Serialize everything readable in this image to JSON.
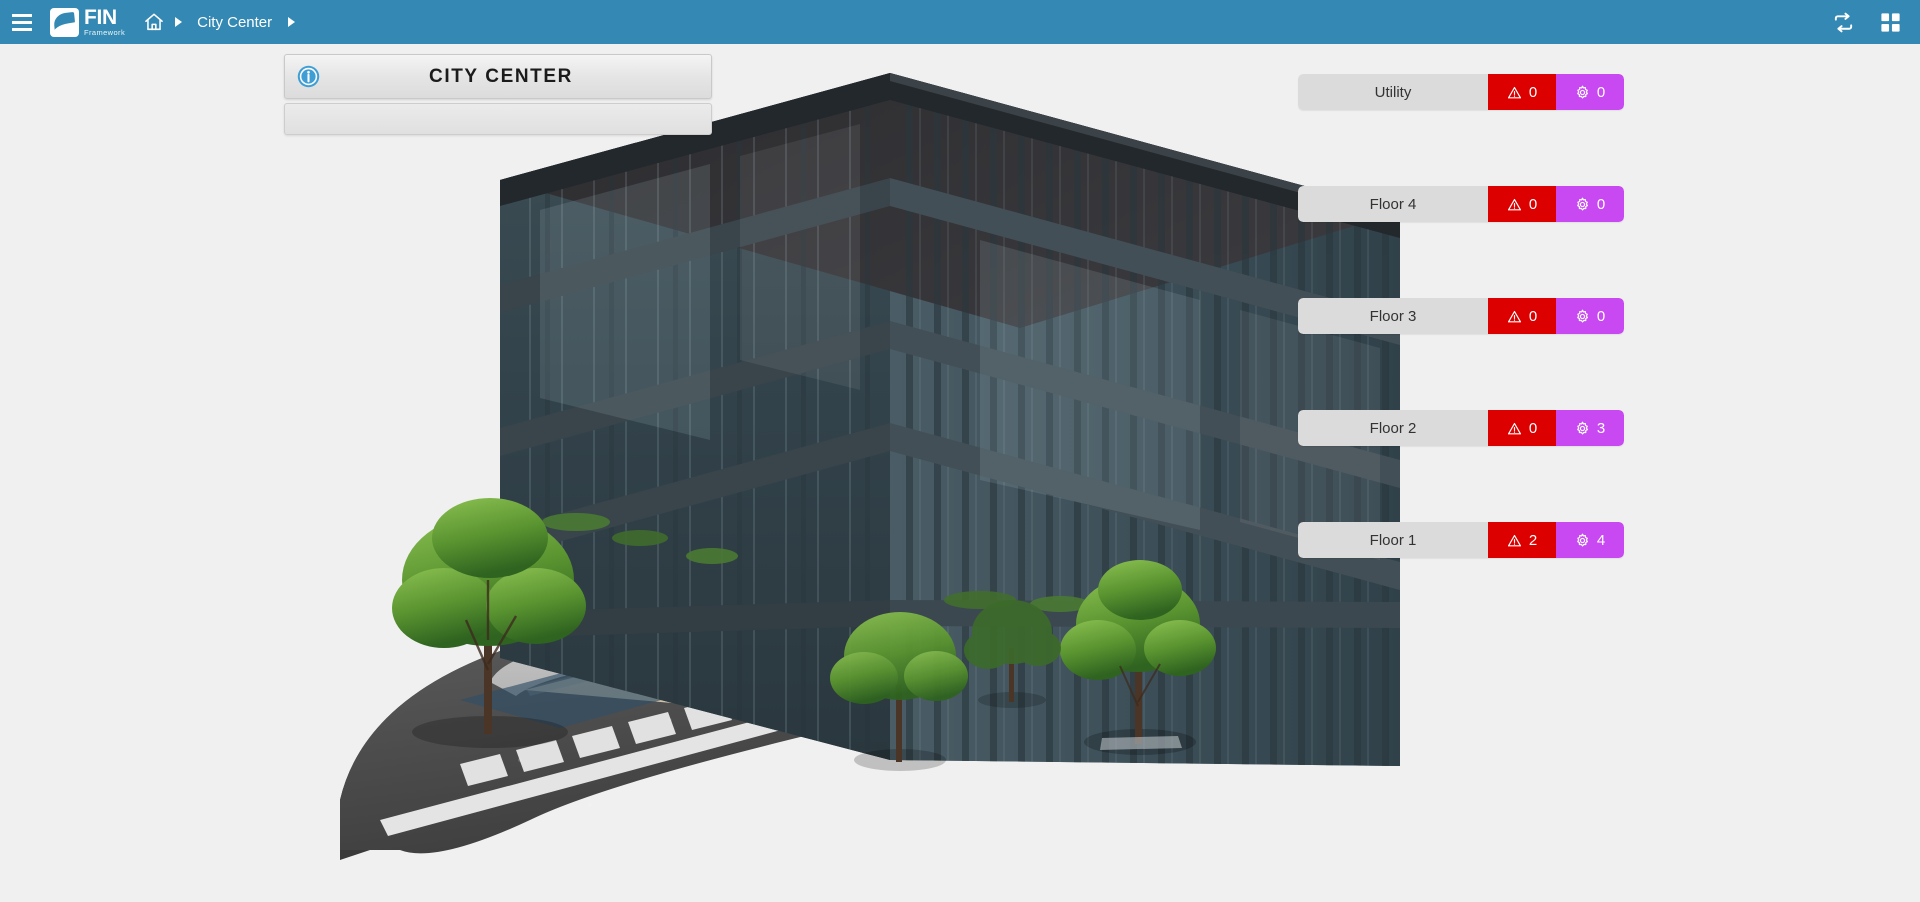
{
  "app": {
    "brand_name": "FIN",
    "brand_subtitle": "Framework"
  },
  "topbar": {
    "menu_icon": "hamburger-menu-icon",
    "home_icon": "home-icon",
    "caret_icon": "caret-right-icon",
    "breadcrumb": "City Center",
    "sync_icon": "sync-refresh-icon",
    "apps_icon": "apps-grid-icon",
    "background_color": "#3389B3"
  },
  "title_card": {
    "info_icon": "info-circle-icon",
    "title": "CITY CENTER",
    "subtitle": ""
  },
  "scene": {
    "label": "city-center-building-3d-render"
  },
  "floors": {
    "alarm_color": "#DD0000",
    "override_color": "#C849F2",
    "row_color": "#DBDBDB",
    "alarm_icon": "warning-triangle-icon",
    "override_icon": "gear-icon",
    "items": [
      {
        "name": "Utility",
        "alarms": "0",
        "overrides": "0"
      },
      {
        "name": "Floor 4",
        "alarms": "0",
        "overrides": "0"
      },
      {
        "name": "Floor 3",
        "alarms": "0",
        "overrides": "0"
      },
      {
        "name": "Floor 2",
        "alarms": "0",
        "overrides": "3"
      },
      {
        "name": "Floor 1",
        "alarms": "2",
        "overrides": "4"
      }
    ]
  }
}
